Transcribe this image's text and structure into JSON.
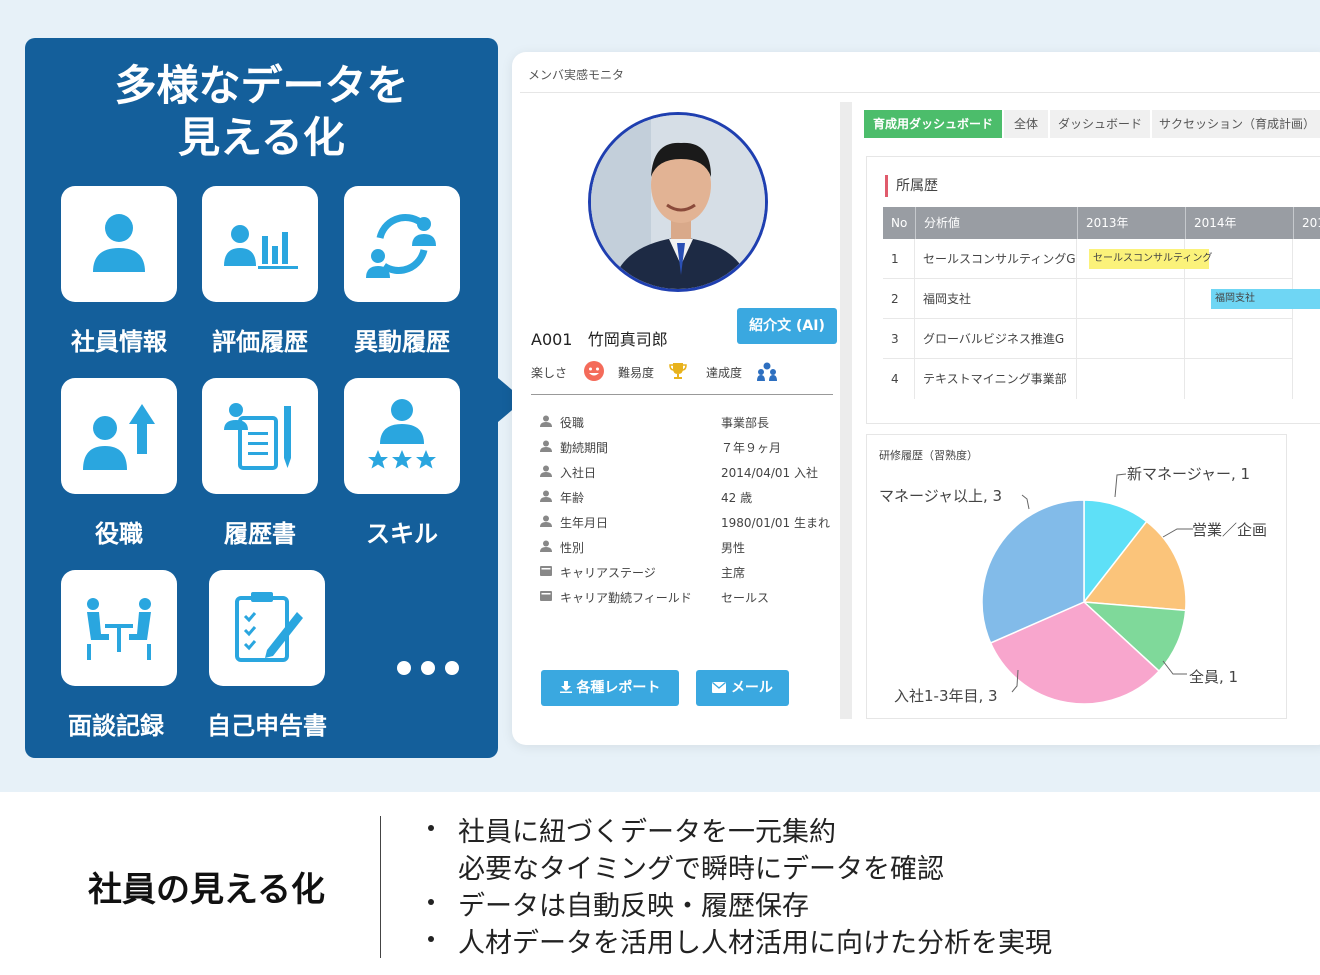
{
  "left_panel": {
    "title_line1": "多様なデータを",
    "title_line2": "見える化",
    "tiles": [
      {
        "label": "社員情報",
        "icon": "person-icon"
      },
      {
        "label": "評価履歴",
        "icon": "person-chart-icon"
      },
      {
        "label": "異動履歴",
        "icon": "transfer-icon"
      },
      {
        "label": "役職",
        "icon": "person-up-arrow-icon"
      },
      {
        "label": "履歴書",
        "icon": "resume-icon"
      },
      {
        "label": "スキル",
        "icon": "person-stars-icon"
      },
      {
        "label": "面談記録",
        "icon": "interview-icon"
      },
      {
        "label": "自己申告書",
        "icon": "clipboard-pen-icon"
      }
    ]
  },
  "app": {
    "title": "メンバ実感モニタ",
    "ai_button": "紹介文 (AI)",
    "employee": {
      "id": "A001",
      "name": "竹岡真司郎"
    },
    "metrics": [
      {
        "label": "楽しさ",
        "icon": "smile-icon"
      },
      {
        "label": "難易度",
        "icon": "trophy-icon"
      },
      {
        "label": "達成度",
        "icon": "team-icon"
      }
    ],
    "info": [
      {
        "key": "役職",
        "value": "事業部長"
      },
      {
        "key": "勤続期間",
        "value": "７年９ヶ月"
      },
      {
        "key": "入社日",
        "value": "2014/04/01 入社"
      },
      {
        "key": "年齢",
        "value": "42 歳"
      },
      {
        "key": "生年月日",
        "value": "1980/01/01 生まれ"
      },
      {
        "key": "性別",
        "value": "男性"
      },
      {
        "key": "キャリアステージ",
        "value": "主席"
      },
      {
        "key": "キャリア勤続フィールド",
        "value": "セールス"
      }
    ],
    "report_button": "各種レポート",
    "mail_button": "メール",
    "tabs": [
      "育成用ダッシュボード",
      "全体",
      "ダッシュボード",
      "サクセッション（育成計画）"
    ],
    "history": {
      "title": "所属歴",
      "headers": [
        "No",
        "分析値",
        "2013年",
        "2014年",
        "201"
      ],
      "rows": [
        {
          "no": "1",
          "name": "セールスコンサルティングG"
        },
        {
          "no": "2",
          "name": "福岡支社"
        },
        {
          "no": "3",
          "name": "グローバルビジネス推進G"
        },
        {
          "no": "4",
          "name": "テキストマイニング事業部"
        }
      ],
      "tags": [
        "セールスコンサルティング",
        "福岡支社"
      ],
      "tag_colors": [
        "#fbf27a",
        "#6fd6f4"
      ]
    },
    "training": {
      "title": "研修履歴（習熟度）",
      "pie_labels": [
        "新マネージャー, 1",
        "営業／企画",
        "全員, 1",
        "入社1-3年目, 3",
        "マネージャ以上, 3"
      ]
    }
  },
  "chart_data": {
    "type": "pie",
    "title": "研修履歴（習熟度）",
    "slices": [
      {
        "label": "新マネージャー",
        "value": 1,
        "color": "#5ee0f7"
      },
      {
        "label": "営業／企画",
        "value": 1.5,
        "color": "#fbc47a"
      },
      {
        "label": "全員",
        "value": 1,
        "color": "#7fd99a"
      },
      {
        "label": "入社1-3年目",
        "value": 3,
        "color": "#f8a6cd"
      },
      {
        "label": "マネージャ以上",
        "value": 3,
        "color": "#82bbe9"
      }
    ]
  },
  "bottom": {
    "title": "社員の見える化",
    "bullets": [
      "社員に紐づくデータを一元集約",
      "必要なタイミングで瞬時にデータを確認",
      "データは自動反映・履歴保存",
      "人材データを活用し人材活用に向けた分析を実現"
    ]
  }
}
